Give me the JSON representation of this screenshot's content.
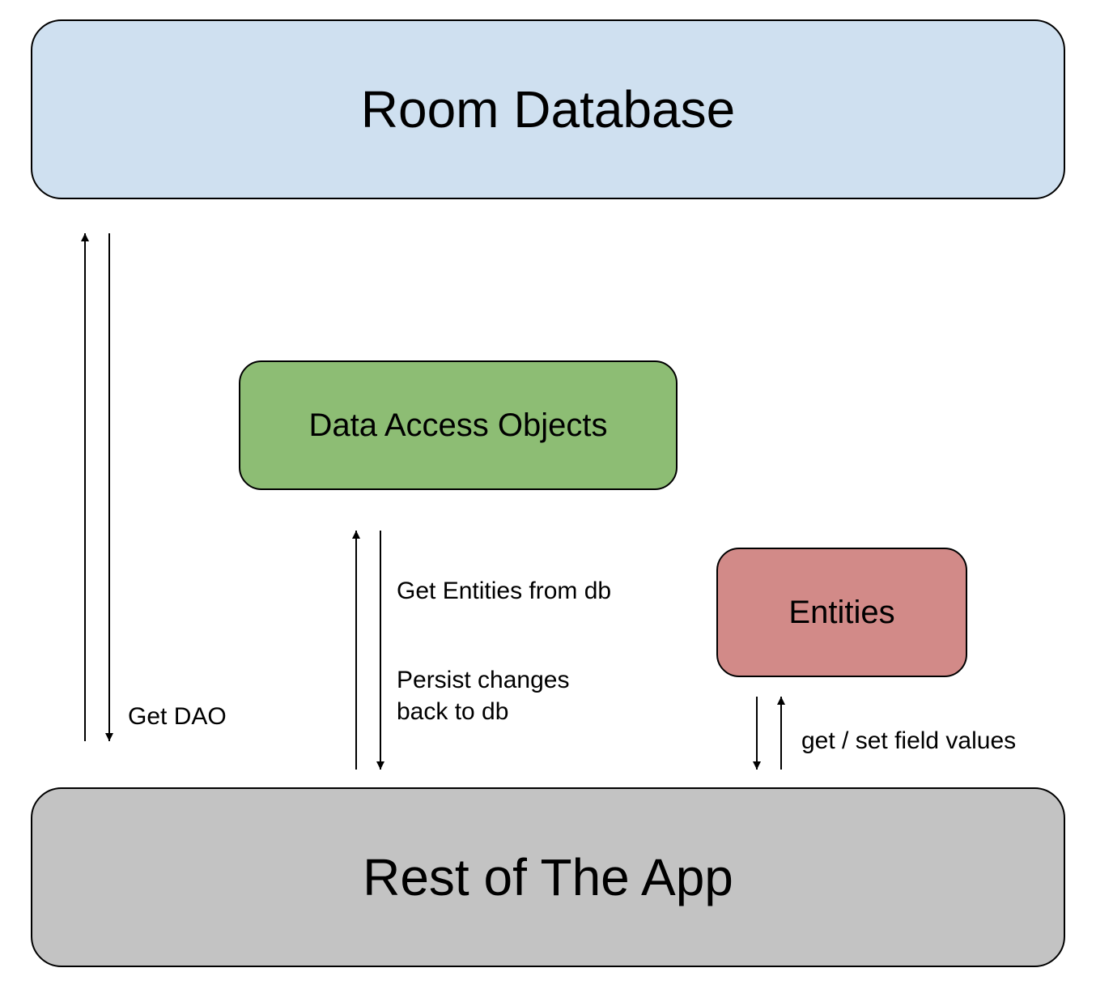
{
  "boxes": {
    "room_database": {
      "label": "Room Database",
      "fill": "#cfe0f0",
      "font_size": 64
    },
    "dao": {
      "label": "Data Access Objects",
      "fill": "#8dbd74",
      "font_size": 40
    },
    "entities": {
      "label": "Entities",
      "fill": "#d28a88",
      "font_size": 40
    },
    "rest_of_app": {
      "label": "Rest of The App",
      "fill": "#c3c3c3",
      "font_size": 64
    }
  },
  "labels": {
    "get_dao": "Get DAO",
    "get_entities": "Get Entities from db",
    "persist_changes": "Persist changes\nback to db",
    "get_set_fields": "get / set field values"
  }
}
